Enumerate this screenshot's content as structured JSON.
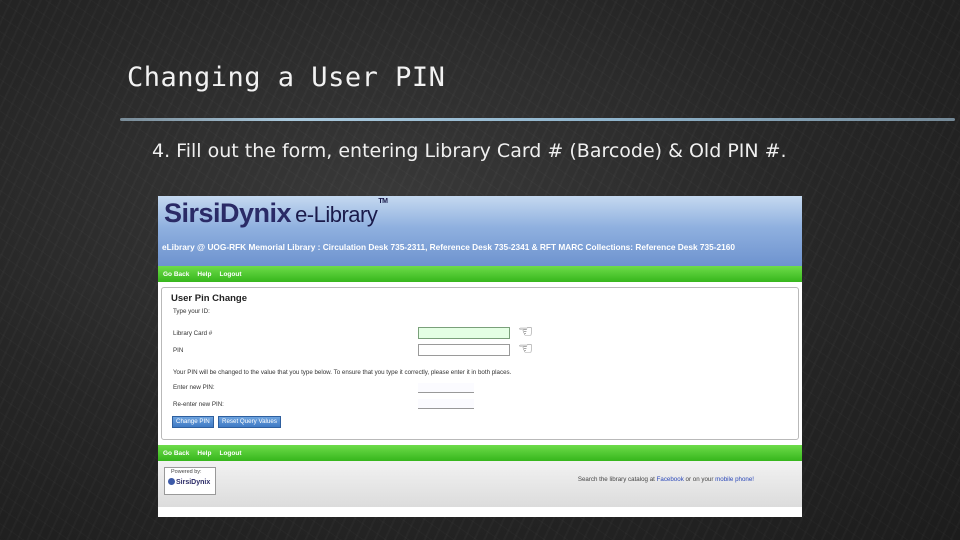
{
  "slide": {
    "title": "Changing a User PIN",
    "instruction": "4. Fill out the form, entering Library Card # (Barcode) & Old PIN #."
  },
  "screenshot": {
    "logo": {
      "brand": "SirsiDynix",
      "product": "e-Library",
      "tm": "TM"
    },
    "header_text": "eLibrary @ UOG-RFK Memorial Library : Circulation Desk 735-2311, Reference Desk 735-2341 & RFT MARC Collections: Reference Desk 735-2160",
    "nav": {
      "go_back": "Go Back",
      "help": "Help",
      "logout": "Logout"
    },
    "form": {
      "title": "User Pin Change",
      "prompt": "Type your ID:",
      "library_card_label": "Library Card #",
      "library_card_value": "",
      "pin_label": "PIN",
      "pin_value": "",
      "notice": "Your PIN will be changed to the value that you type below. To ensure that you type it correctly, please enter it in both places.",
      "new_pin_label": "Enter new PIN:",
      "reenter_pin_label": "Re-enter new PIN:",
      "change_pin_button": "Change PIN",
      "reset_button": "Reset Query Values"
    },
    "footer": {
      "powered_by": "Powered by:",
      "powered_logo": "SirsiDynix",
      "search_text_before": "Search the library catalog at",
      "facebook_link": "Facebook",
      "search_text_mid": "or on your",
      "mobile_link": "mobile phone!"
    },
    "colors": {
      "nav_green": "#36b61c",
      "header_blue": "#6e93cf",
      "button_blue": "#3f7ac4"
    }
  },
  "icons": [
    "pointing-hand-icon"
  ]
}
